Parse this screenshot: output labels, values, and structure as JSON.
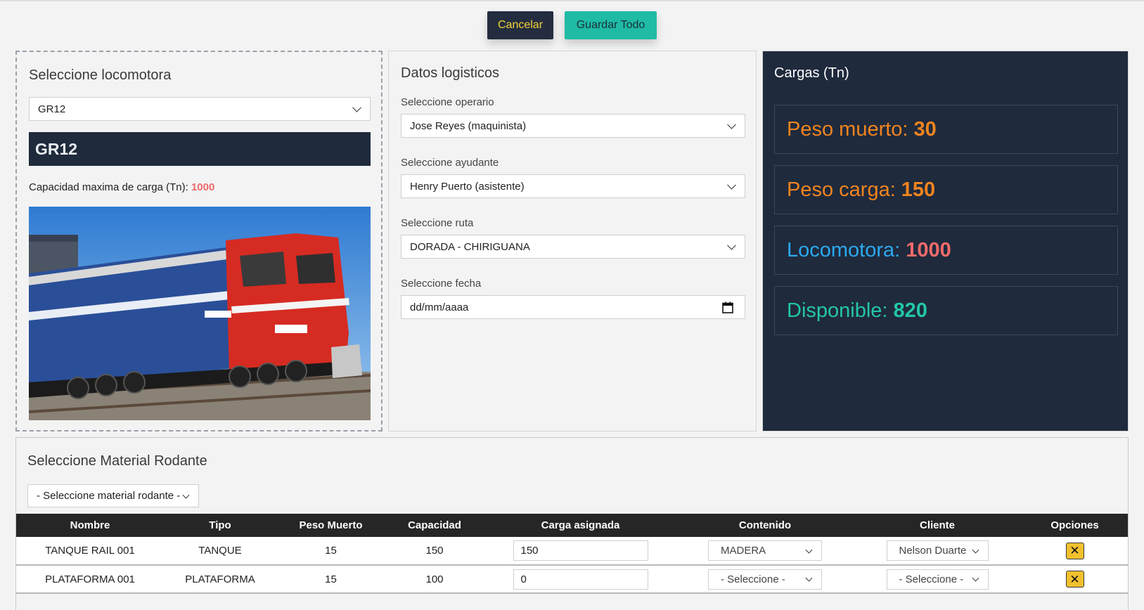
{
  "toolbar": {
    "cancel_label": "Cancelar",
    "save_label": "Guardar Todo"
  },
  "locomotora": {
    "title": "Seleccione locomotora",
    "selected": "GR12",
    "banner": "GR12",
    "capacity_label": "Capacidad maxima de carga (Tn):",
    "capacity_value": "1000"
  },
  "logistica": {
    "title": "Datos logisticos",
    "operario_label": "Seleccione operario",
    "operario_value": "Jose Reyes (maquinista)",
    "ayudante_label": "Seleccione ayudante",
    "ayudante_value": "Henry Puerto (asistente)",
    "ruta_label": "Seleccione ruta",
    "ruta_value": "DORADA - CHIRIGUANA",
    "fecha_label": "Seleccione fecha",
    "fecha_placeholder": "dd/mm/aaaa"
  },
  "cargas": {
    "title": "Cargas (Tn)",
    "items": [
      {
        "label": "Peso muerto:",
        "value": "30",
        "label_color": "#f0841f",
        "value_color": "#f0841f"
      },
      {
        "label": "Peso carga:",
        "value": "150",
        "label_color": "#f0841f",
        "value_color": "#f0841f"
      },
      {
        "label": "Locomotora:",
        "value": "1000",
        "label_color": "#2aa9f0",
        "value_color": "#f26b6b"
      },
      {
        "label": "Disponible:",
        "value": "820",
        "label_color": "#23c6a9",
        "value_color": "#23c6a9"
      }
    ]
  },
  "material": {
    "title": "Seleccione Material Rodante",
    "select_placeholder": "- Seleccione material rodante -",
    "columns": [
      "Nombre",
      "Tipo",
      "Peso Muerto",
      "Capacidad",
      "Carga asignada",
      "Contenido",
      "Cliente",
      "Opciones"
    ],
    "rows": [
      {
        "nombre": "TANQUE RAIL 001",
        "tipo": "TANQUE",
        "peso": "15",
        "capacidad": "150",
        "carga": "150",
        "contenido": "MADERA",
        "cliente": "Nelson Duarte"
      },
      {
        "nombre": "PLATAFORMA 001",
        "tipo": "PLATAFORMA",
        "peso": "15",
        "capacidad": "100",
        "carga": "0",
        "contenido": "- Seleccione -",
        "cliente": "- Seleccione -"
      }
    ]
  },
  "icons": {
    "chevron": "chevron-down-icon",
    "calendar": "calendar-icon",
    "delete": "close-x-icon"
  },
  "colors": {
    "dark_panel": "#1f2a3c",
    "accent_teal": "#1fbba5",
    "cancel_text": "#f4d33b",
    "delete_button": "#f2c12e"
  }
}
